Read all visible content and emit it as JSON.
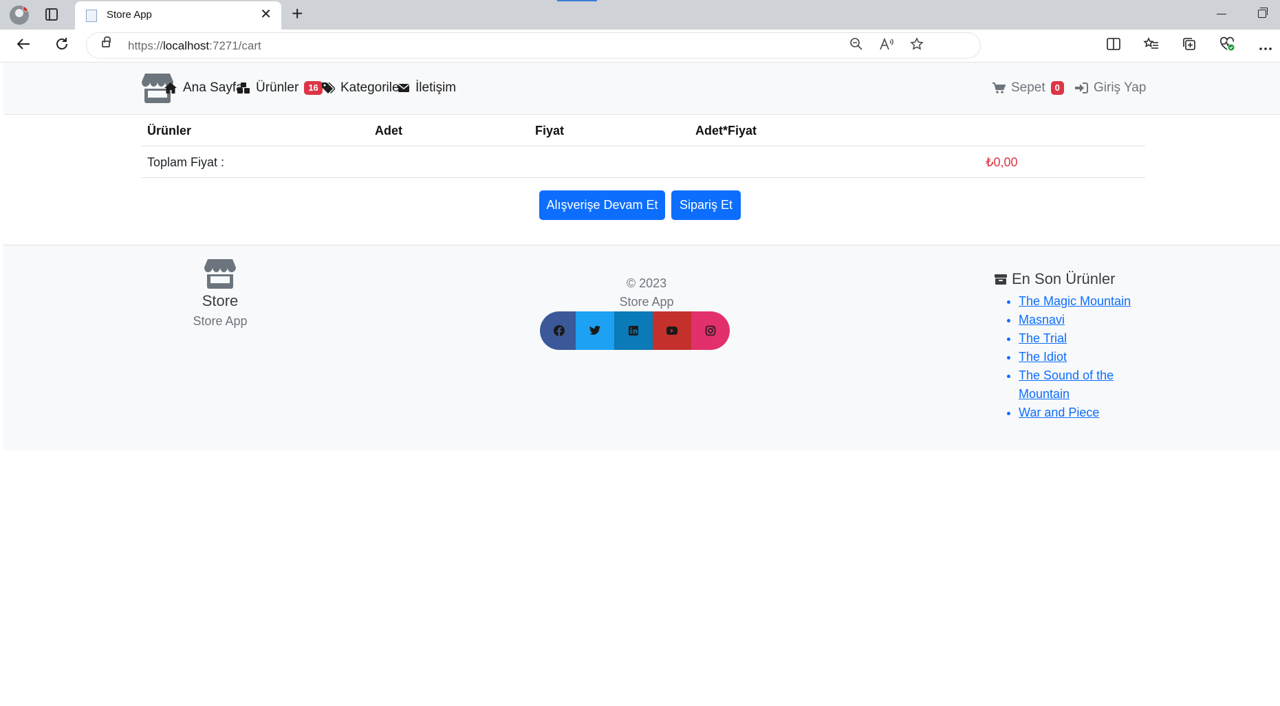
{
  "browser": {
    "tab_title": "Store App",
    "url_scheme": "https://",
    "url_host": "localhost",
    "url_rest": ":7271/cart"
  },
  "navbar": {
    "items": [
      {
        "label": "Ana Sayfa",
        "icon": "home-icon"
      },
      {
        "label": "Ürünler",
        "icon": "cubes-icon",
        "badge": "16"
      },
      {
        "label": "Kategoriler",
        "icon": "tags-icon"
      },
      {
        "label": "İletişim",
        "icon": "envelope-icon"
      }
    ],
    "cart_label": "Sepet",
    "cart_badge": "0",
    "login_label": "Giriş Yap"
  },
  "cart": {
    "headers": [
      "Ürünler",
      "Adet",
      "Fiyat",
      "Adet*Fiyat"
    ],
    "total_label": "Toplam Fiyat :",
    "total_value": "₺0,00"
  },
  "buttons": {
    "continue": "Alışverişe Devam Et",
    "order": "Sipariş Et"
  },
  "footer": {
    "brand_name": "Store",
    "brand_sub": "Store App",
    "copyright": "© 2023",
    "app_name": "Store App",
    "latest_title": "En Son Ürünler",
    "latest_products": [
      "The Magic Mountain",
      "Masnavi",
      "The Trial",
      "The Idiot",
      "The Sound of the Mountain",
      "War and Piece"
    ],
    "socials": [
      {
        "name": "facebook-icon",
        "color": "#3b5998"
      },
      {
        "name": "twitter-icon",
        "color": "#1da1f2"
      },
      {
        "name": "linkedin-icon",
        "color": "#0a7ab8"
      },
      {
        "name": "youtube-icon",
        "color": "#c4302b"
      },
      {
        "name": "instagram-icon",
        "color": "#e1306c"
      }
    ]
  },
  "colors": {
    "primary": "#0d6efd",
    "danger": "#dc3545"
  }
}
